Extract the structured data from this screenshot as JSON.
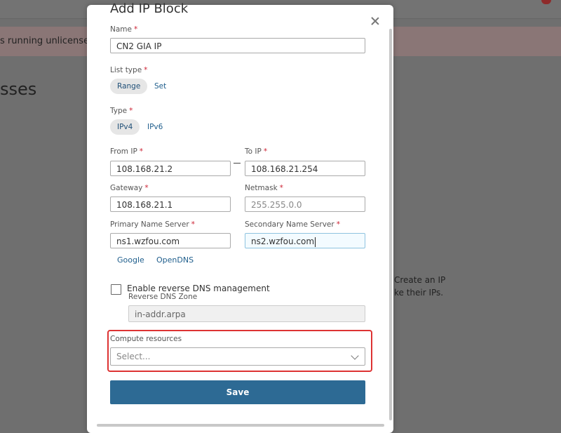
{
  "background": {
    "banner_text": "s running unlicensed.",
    "heading": "sses",
    "side_line1": "Create an IP",
    "side_line2": "ke their IPs."
  },
  "modal": {
    "title": "Add IP Block",
    "name": {
      "label": "Name",
      "required": "*",
      "value": "CN2 GIA IP"
    },
    "list_type": {
      "label": "List type",
      "required": "*",
      "options": [
        "Range",
        "Set"
      ],
      "selected": "Range"
    },
    "type": {
      "label": "Type",
      "required": "*",
      "options": [
        "IPv4",
        "IPv6"
      ],
      "selected": "IPv4"
    },
    "from_ip": {
      "label": "From IP",
      "required": "*",
      "value": "108.168.21.2"
    },
    "to_ip": {
      "label": "To IP",
      "required": "*",
      "value": "108.168.21.254"
    },
    "gateway": {
      "label": "Gateway",
      "required": "*",
      "value": "108.168.21.1"
    },
    "netmask": {
      "label": "Netmask",
      "required": "*",
      "placeholder": "255.255.0.0"
    },
    "primary_ns": {
      "label": "Primary Name Server",
      "required": "*",
      "value": "ns1.wzfou.com"
    },
    "secondary_ns": {
      "label": "Secondary Name Server",
      "required": "*",
      "value": "ns2.wzfou.com"
    },
    "presets": [
      "Google",
      "OpenDNS"
    ],
    "reverse_dns": {
      "label": "Enable reverse DNS management",
      "checked": false,
      "zone_label": "Reverse DNS Zone",
      "zone_value": "in-addr.arpa"
    },
    "compute_resources": {
      "label": "Compute resources",
      "placeholder": "Select..."
    },
    "save_label": "Save"
  }
}
